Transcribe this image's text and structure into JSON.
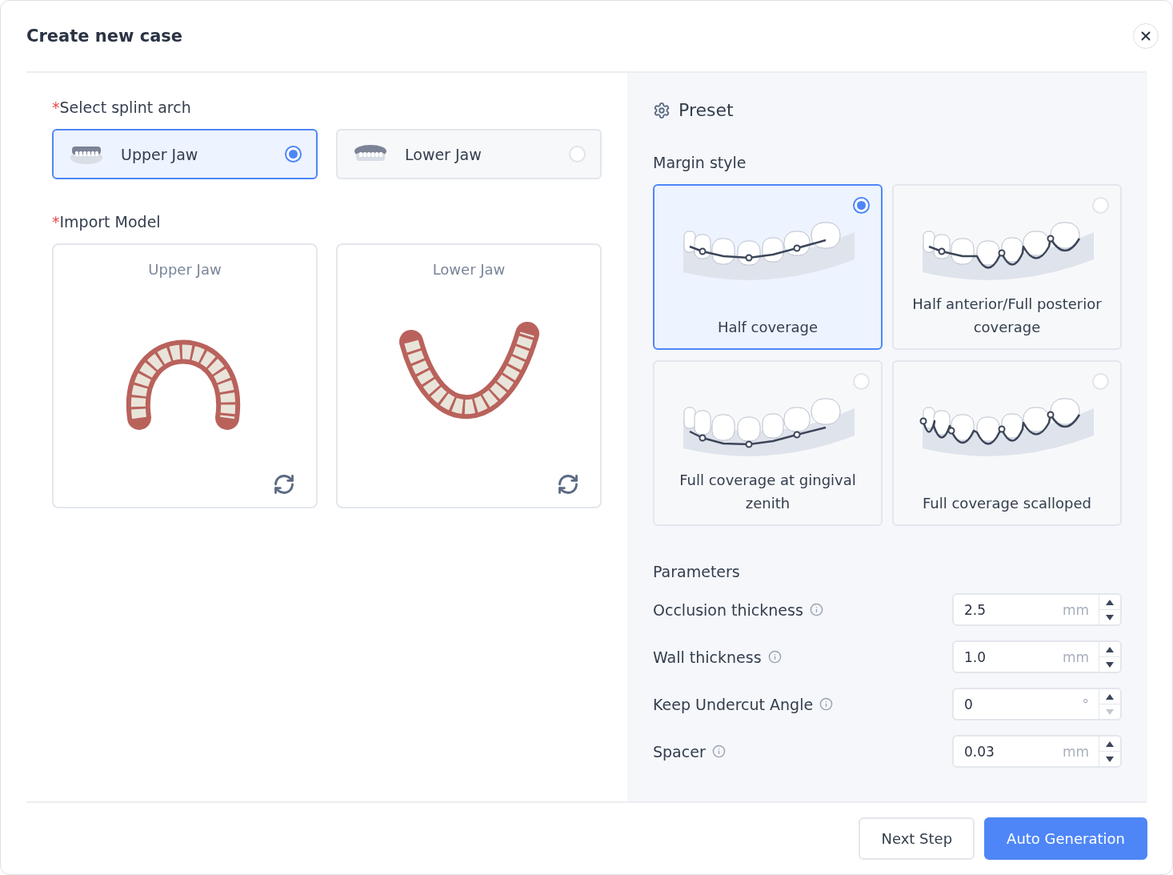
{
  "dialog": {
    "title": "Create new case"
  },
  "arch": {
    "required_mark": "*",
    "label": "Select splint arch",
    "options": [
      {
        "label": "Upper Jaw",
        "kind": "upper",
        "selected": true
      },
      {
        "label": "Lower Jaw",
        "kind": "lower",
        "selected": false
      }
    ]
  },
  "import": {
    "required_mark": "*",
    "label": "Import Model",
    "models": [
      {
        "title": "Upper Jaw",
        "kind": "upper"
      },
      {
        "title": "Lower Jaw",
        "kind": "lower"
      }
    ]
  },
  "preset": {
    "title": "Preset",
    "margin_label": "Margin style",
    "margins": [
      {
        "label": "Half coverage",
        "kind": "half",
        "selected": true
      },
      {
        "label": "Half anterior/Full posterior coverage",
        "kind": "mixed",
        "selected": false
      },
      {
        "label": "Full coverage at gingival zenith",
        "kind": "gingival",
        "selected": false
      },
      {
        "label": "Full coverage scalloped",
        "kind": "scalloped",
        "selected": false
      }
    ],
    "parameters_label": "Parameters",
    "parameters": [
      {
        "label": "Occlusion thickness",
        "value": "2.5",
        "unit": "mm",
        "down_disabled": false
      },
      {
        "label": "Wall thickness",
        "value": "1.0",
        "unit": "mm",
        "down_disabled": false
      },
      {
        "label": "Keep Undercut Angle",
        "value": "0",
        "unit": "°",
        "down_disabled": true
      },
      {
        "label": "Spacer",
        "value": "0.03",
        "unit": "mm",
        "down_disabled": false
      }
    ]
  },
  "buttons": [
    {
      "label": "Next Step",
      "kind": "secondary"
    },
    {
      "label": "Auto Generation",
      "kind": "primary"
    }
  ]
}
